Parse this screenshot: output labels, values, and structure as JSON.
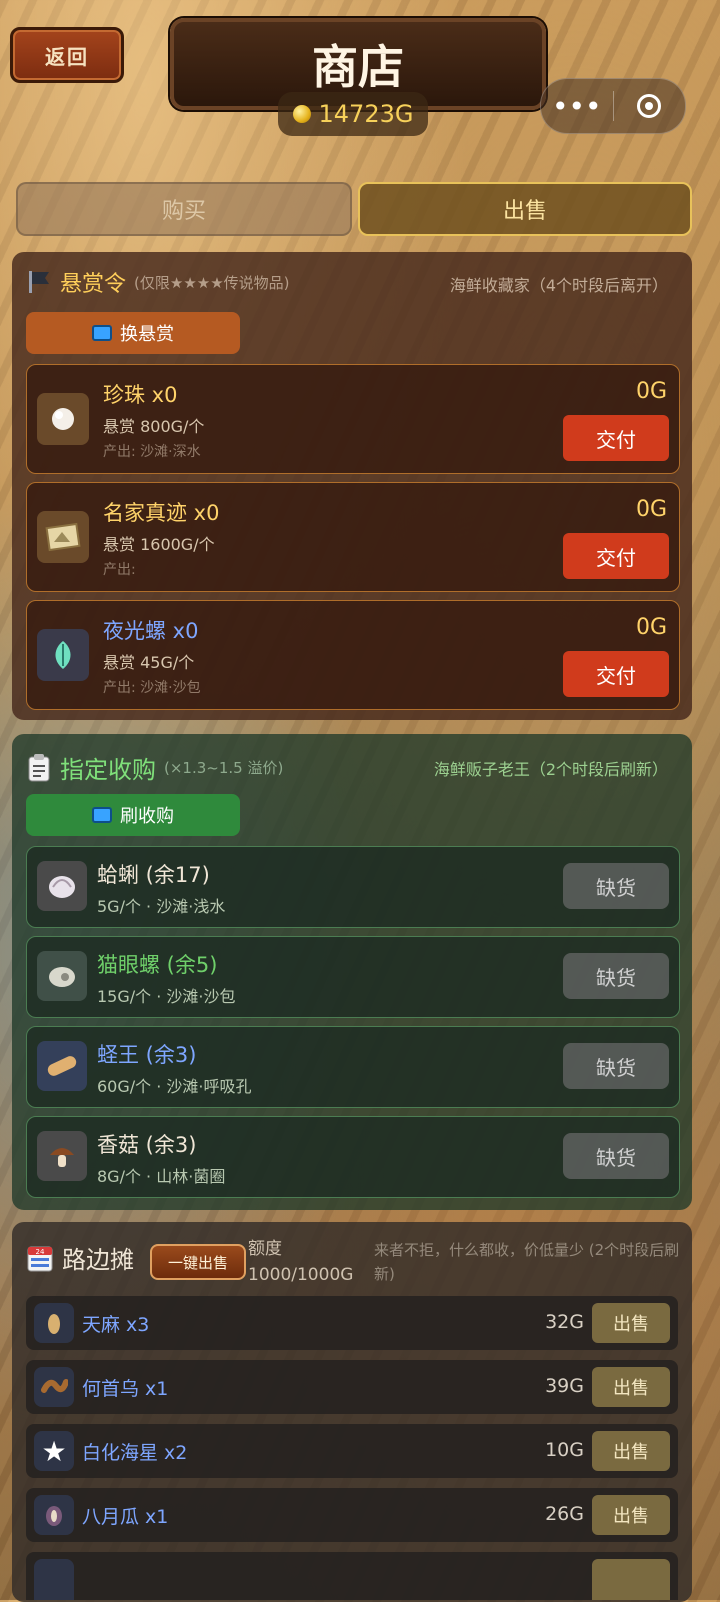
{
  "header": {
    "back_label": "返回",
    "title": "商店",
    "gold": "14723G"
  },
  "tabs": [
    {
      "label": "购买",
      "active": false
    },
    {
      "label": "出售",
      "active": true
    }
  ],
  "bounty": {
    "title": "悬赏令",
    "subtitle": "(仅限★★★★传说物品)",
    "merchant_note": "海鲜收藏家（4个时段后离开）",
    "refresh_label": "换悬赏",
    "items": [
      {
        "name": "珍珠 x0",
        "reward": "悬赏 800G/个",
        "source": "产出: 沙滩·深水",
        "value": "0G",
        "button": "交付",
        "name_color": "#ffd36a",
        "icon": "pearl-icon"
      },
      {
        "name": "名家真迹 x0",
        "reward": "悬赏 1600G/个",
        "source": "产出:",
        "value": "0G",
        "button": "交付",
        "name_color": "#ffd36a",
        "icon": "painting-icon"
      },
      {
        "name": "夜光螺 x0",
        "reward": "悬赏 45G/个",
        "source": "产出: 沙滩·沙包",
        "value": "0G",
        "button": "交付",
        "name_color": "#7ea6ff",
        "icon": "conch-icon"
      }
    ]
  },
  "purchase": {
    "title": "指定收购",
    "subtitle": "(×1.3~1.5 溢价)",
    "merchant_note": "海鲜贩子老王（2个时段后刷新）",
    "refresh_label": "刷收购",
    "items": [
      {
        "name": "蛤蜊 (余17)",
        "detail": "5G/个 · 沙滩·浅水",
        "button": "缺货",
        "name_color": "#f0e6d6",
        "icon": "clam-icon"
      },
      {
        "name": "猫眼螺 (余5)",
        "detail": "15G/个 · 沙滩·沙包",
        "button": "缺货",
        "name_color": "#6fd06a",
        "icon": "cat-eye-snail-icon"
      },
      {
        "name": "蛏王 (余3)",
        "detail": "60G/个 · 沙滩·呼吸孔",
        "button": "缺货",
        "name_color": "#7ea6ff",
        "icon": "razor-clam-icon"
      },
      {
        "name": "香菇 (余3)",
        "detail": "8G/个 · 山林·菌圈",
        "button": "缺货",
        "name_color": "#f0e6d6",
        "icon": "mushroom-icon"
      }
    ]
  },
  "street": {
    "title": "路边摊",
    "one_click_label": "一键出售",
    "quota_label": "额度",
    "quota_value": "1000/1000G",
    "note": "来者不拒，什么都收，价低量少 (2个时段后刷新)",
    "items": [
      {
        "name": "天麻 x3",
        "price": "32G",
        "button": "出售",
        "icon": "gastrodia-icon"
      },
      {
        "name": "何首乌 x1",
        "price": "39G",
        "button": "出售",
        "icon": "fleeceflower-icon"
      },
      {
        "name": "白化海星 x2",
        "price": "10G",
        "button": "出售",
        "icon": "starfish-icon"
      },
      {
        "name": "八月瓜 x1",
        "price": "26G",
        "button": "出售",
        "icon": "akebia-icon"
      }
    ]
  }
}
